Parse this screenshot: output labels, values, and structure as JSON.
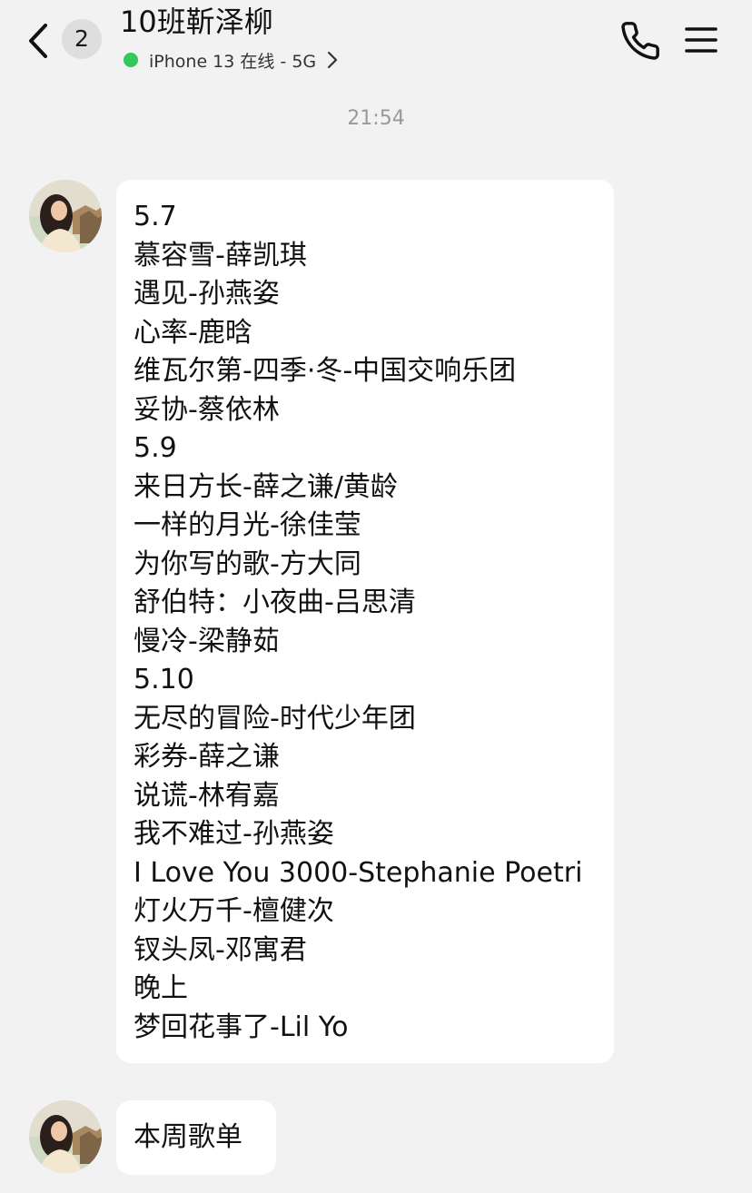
{
  "header": {
    "unread_count": "2",
    "contact_name": "10班靳泽柳",
    "device_status": "iPhone 13 在线 - 5G",
    "online_color": "#34c759",
    "icons": [
      "back-arrow-icon",
      "chevron-right-icon",
      "phone-icon",
      "menu-icon"
    ]
  },
  "chat": {
    "timestamp": "21:54",
    "messages": [
      {
        "sender": "contact",
        "lines": [
          "5.7",
          "慕容雪-薛凯琪",
          "遇见-孙燕姿",
          "心率-鹿晗",
          "维瓦尔第-四季·冬-中国交响乐团",
          "妥协-蔡依林",
          "5.9",
          "来日方长-薛之谦/黄龄",
          "一样的月光-徐佳莹",
          "为你写的歌-方大同",
          "舒伯特：小夜曲-吕思清",
          "慢冷-梁静茹",
          "5.10",
          "无尽的冒险-时代少年团",
          "彩券-薛之谦",
          "说谎-林宥嘉",
          "我不难过-孙燕姿",
          "I Love You 3000-Stephanie Poetri",
          "灯火万千-檀健次",
          "钗头凤-邓寓君",
          "晚上",
          "梦回花事了-Lil Yo"
        ]
      },
      {
        "sender": "contact",
        "text": "本周歌单"
      }
    ]
  }
}
